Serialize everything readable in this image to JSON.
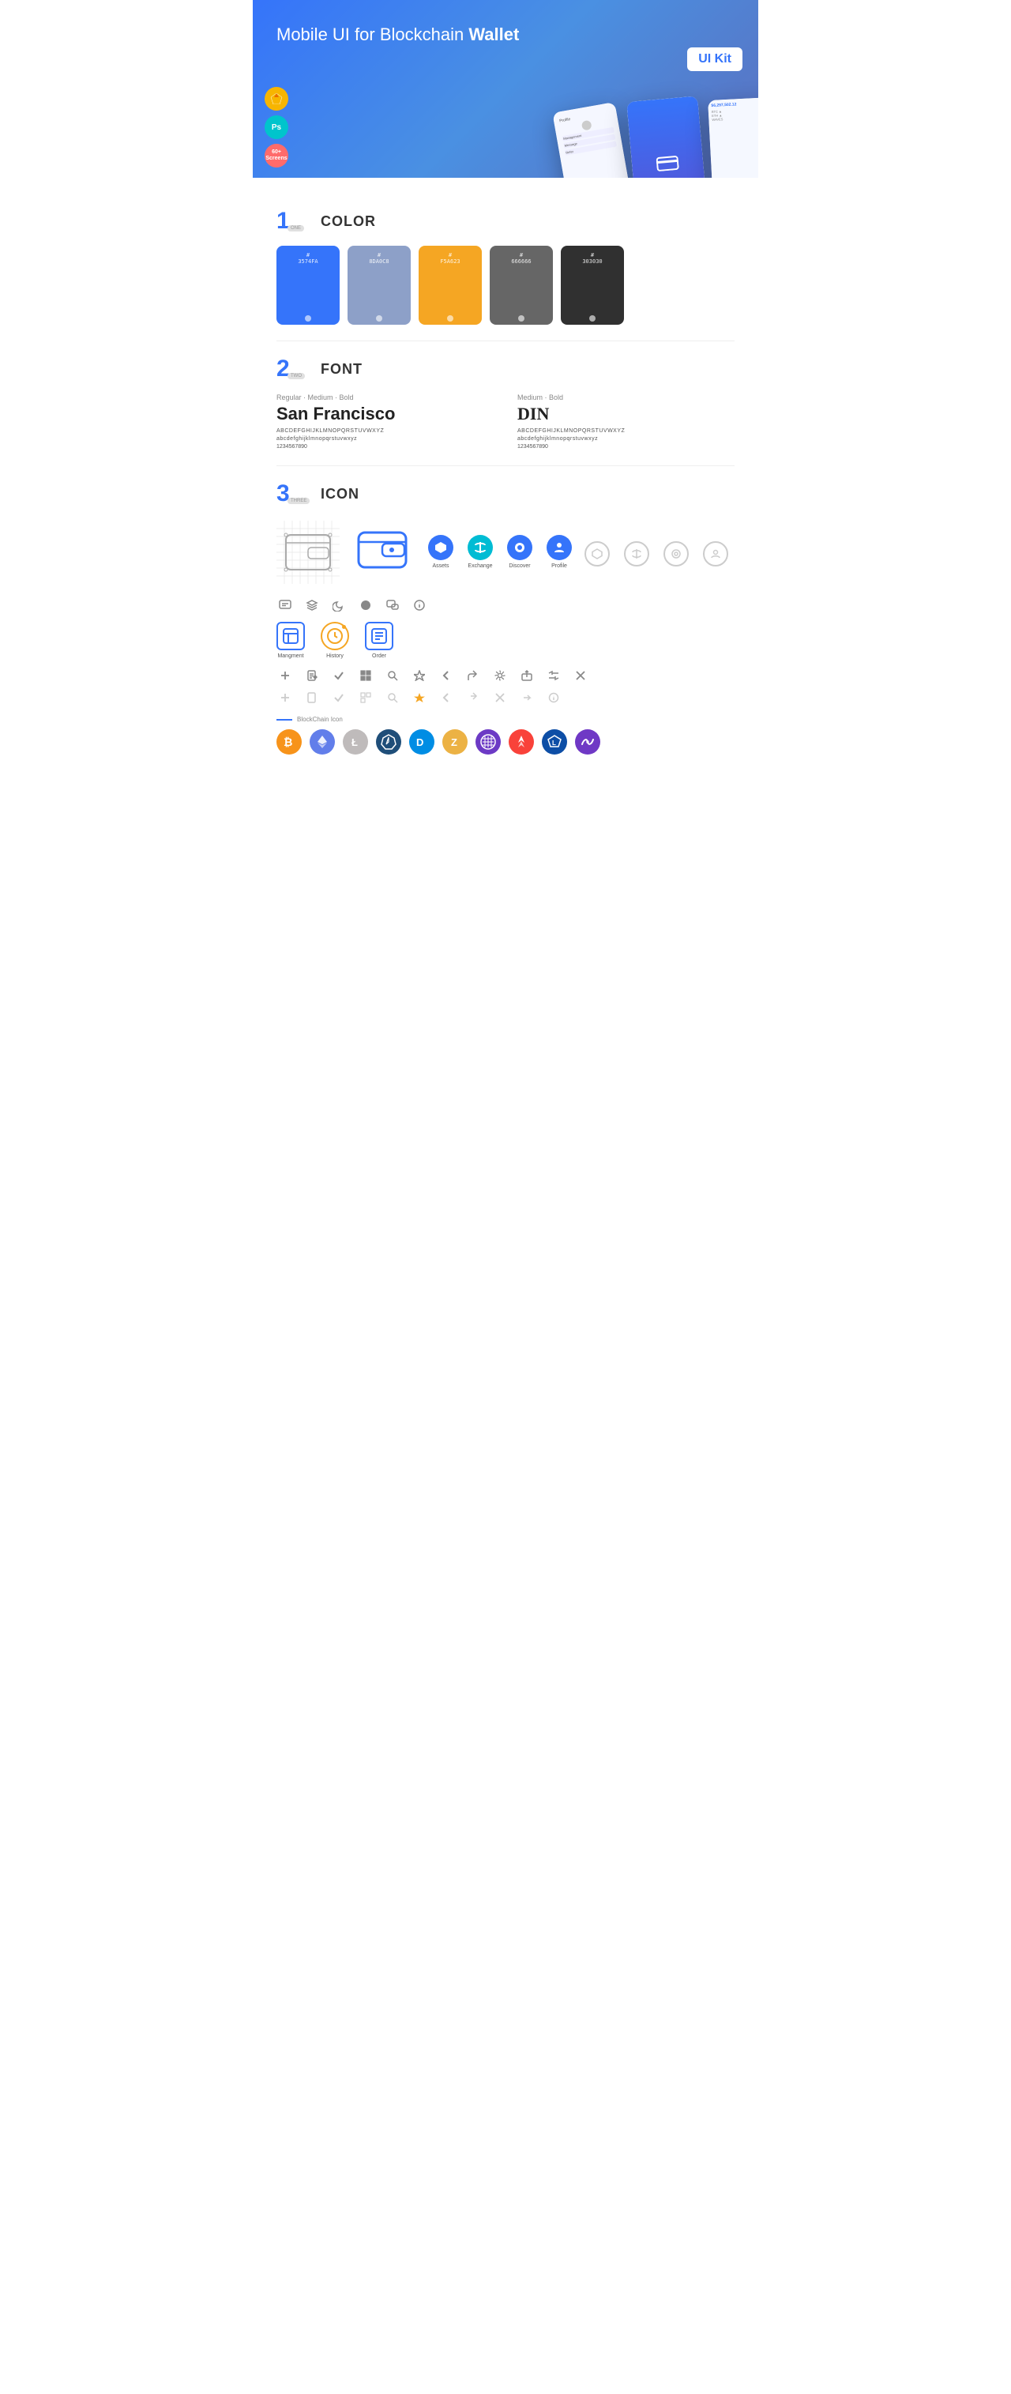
{
  "hero": {
    "title_regular": "Mobile UI for Blockchain ",
    "title_bold": "Wallet",
    "badge": "UI Kit",
    "sketch_label": "S",
    "ps_label": "Ps",
    "screens_label": "60+\nScreens"
  },
  "sections": {
    "color": {
      "number": "1",
      "tag": "ONE",
      "title": "COLOR",
      "swatches": [
        {
          "hex": "#3574FA",
          "label": "3574FA"
        },
        {
          "hex": "#8DA0C8",
          "label": "8DA0C8"
        },
        {
          "hex": "#F5A623",
          "label": "F5A623"
        },
        {
          "hex": "#666666",
          "label": "666666"
        },
        {
          "hex": "#303030",
          "label": "303030"
        }
      ]
    },
    "font": {
      "number": "2",
      "tag": "TWO",
      "title": "FONT",
      "fonts": [
        {
          "style_label": "Regular · Medium · Bold",
          "name": "San Francisco",
          "uppercase": "ABCDEFGHIJKLMNOPQRSTUVWXYZ",
          "lowercase": "abcdefghijklmnopqrstuvwxyz",
          "numbers": "1234567890"
        },
        {
          "style_label": "Medium · Bold",
          "name": "DIN",
          "uppercase": "ABCDEFGHIJKLMNOPQRSTUVWXYZ",
          "lowercase": "abcdefghijklmnopqrstuvwxyz",
          "numbers": "1234567890"
        }
      ]
    },
    "icon": {
      "number": "3",
      "tag": "THREE",
      "title": "ICON",
      "nav_icons": [
        {
          "label": "Assets",
          "color": "blue"
        },
        {
          "label": "Exchange",
          "color": "teal"
        },
        {
          "label": "Discover",
          "color": "red"
        },
        {
          "label": "Profile",
          "color": "blue"
        }
      ],
      "mgmt_icons": [
        {
          "label": "Mangment"
        },
        {
          "label": "History"
        },
        {
          "label": "Order"
        }
      ],
      "blockchain_label": "BlockChain Icon",
      "crypto_names": [
        "BTC",
        "ETH",
        "LTC",
        "WAVES",
        "DASH",
        "ZEC",
        "GRID",
        "ARK",
        "LSK",
        "DOT"
      ]
    }
  }
}
